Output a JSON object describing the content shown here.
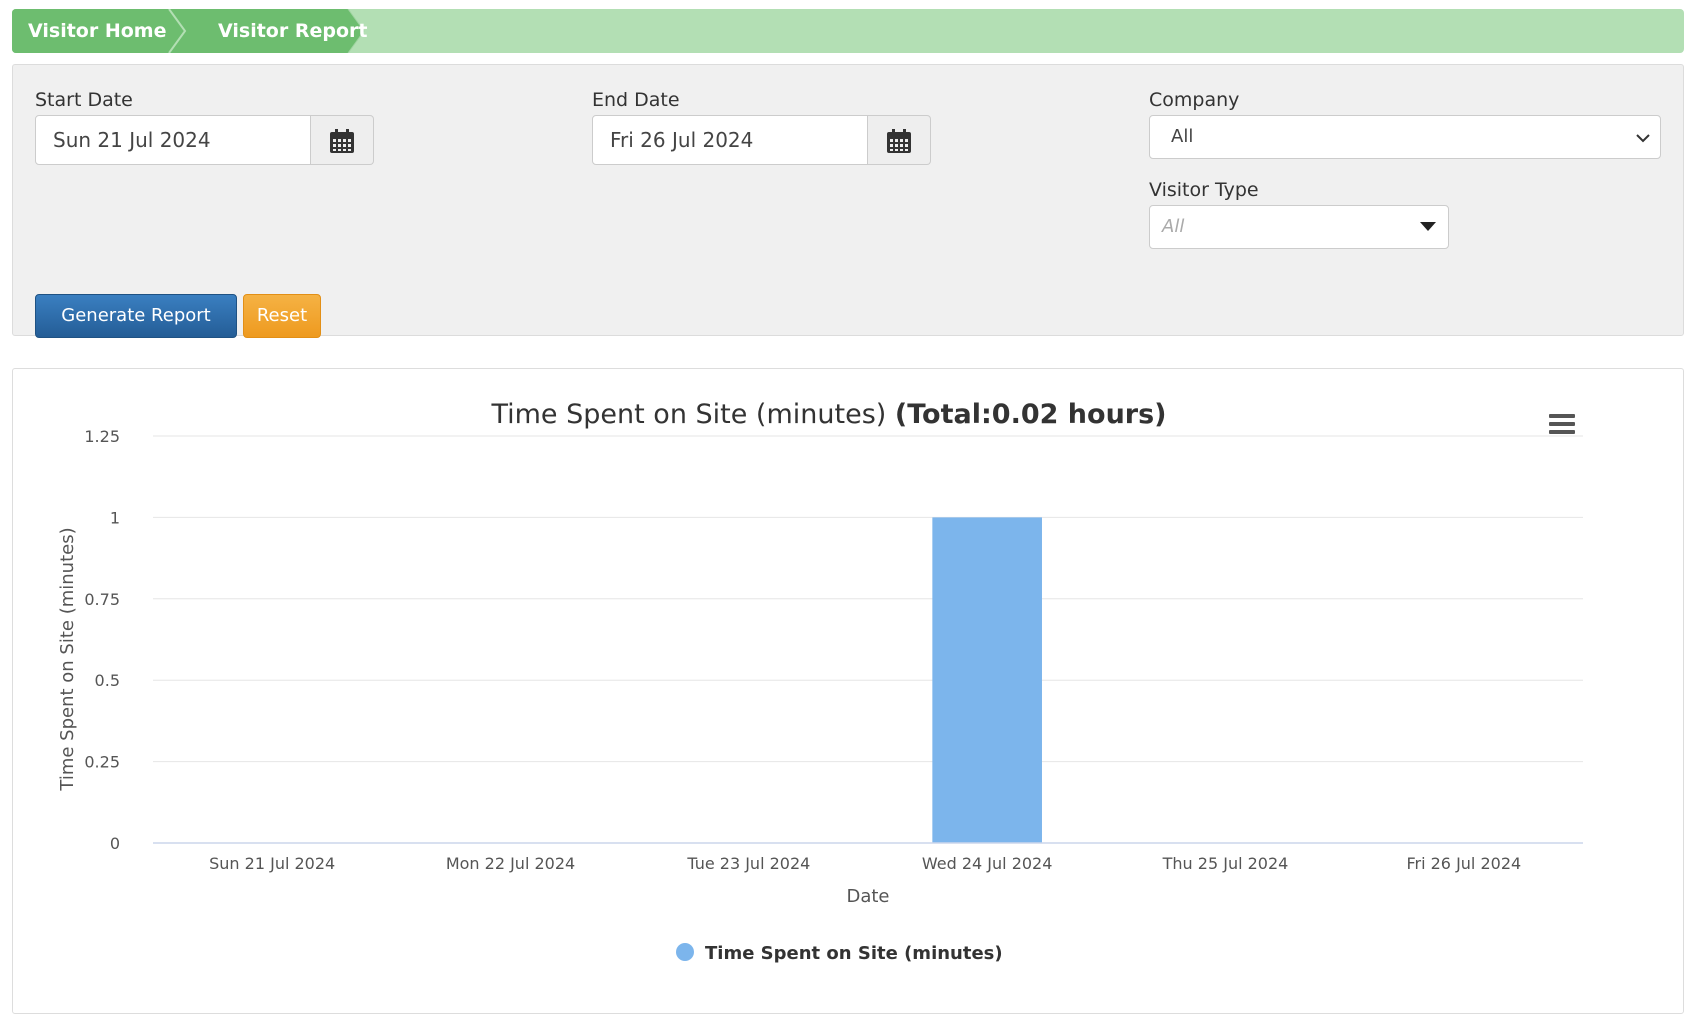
{
  "breadcrumb": {
    "home": "Visitor Home",
    "current": "Visitor Report"
  },
  "filters": {
    "start_date_label": "Start Date",
    "start_date_value": "Sun 21 Jul 2024",
    "end_date_label": "End Date",
    "end_date_value": "Fri 26 Jul 2024",
    "company_label": "Company",
    "company_value": "All",
    "visitor_type_label": "Visitor Type",
    "visitor_type_placeholder": "All"
  },
  "buttons": {
    "generate": "Generate Report",
    "reset": "Reset"
  },
  "colors": {
    "breadcrumb_bg": "#b3dfb4",
    "breadcrumb_active": "#6dbd6f",
    "bar": "#7cb5ec",
    "generate": "#2d6ca9",
    "reset": "#f0a22e"
  },
  "icons": {
    "calendar": "calendar-icon",
    "menu": "hamburger-menu-icon",
    "chevron": "chevron-down-icon",
    "caret": "caret-down-icon"
  },
  "chart_data": {
    "type": "bar",
    "title": "Time Spent on Site (minutes)",
    "title_total": "(Total:0.02 hours)",
    "xlabel": "Date",
    "ylabel": "Time Spent on Site (minutes)",
    "categories": [
      "Sun 21 Jul 2024",
      "Mon 22 Jul 2024",
      "Tue 23 Jul 2024",
      "Wed 24 Jul 2024",
      "Thu 25 Jul 2024",
      "Fri 26 Jul 2024"
    ],
    "series": [
      {
        "name": "Time Spent on Site (minutes)",
        "values": [
          0,
          0,
          0,
          1,
          0,
          0
        ]
      }
    ],
    "ylim": [
      0,
      1.25
    ],
    "yticks": [
      "0",
      "0.25",
      "0.5",
      "0.75",
      "1",
      "1.25"
    ],
    "grid": true,
    "legend": "bottom-center"
  }
}
